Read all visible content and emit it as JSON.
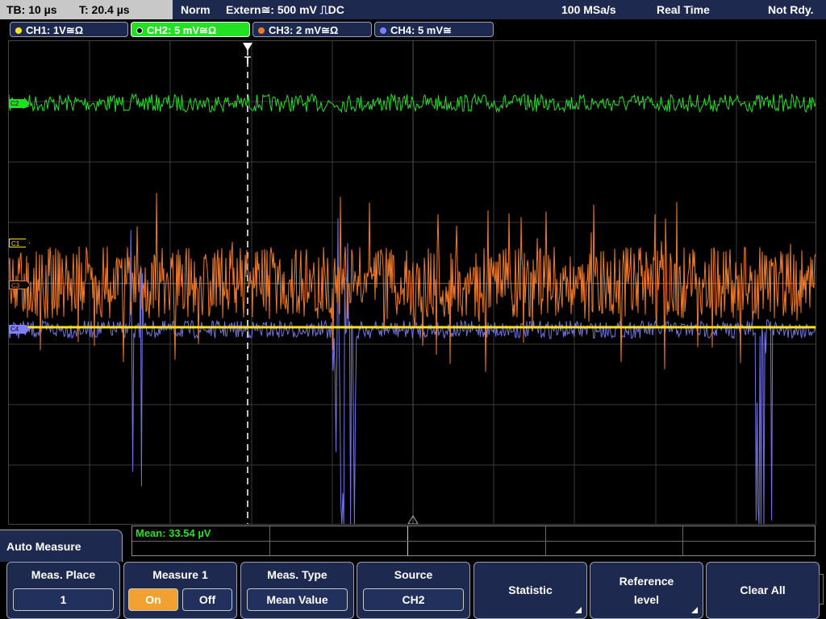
{
  "status": {
    "timebase": "TB: 10 µs",
    "trigger_pos": "T: 20.4 µs",
    "mode": "Norm",
    "trigger": "Extern≅: 500 mV ⎍DC",
    "sample_rate": "100 MSa/s",
    "acq_mode": "Real Time",
    "state": "Not Rdy."
  },
  "channels": [
    {
      "label": "CH1: 1V≅Ω",
      "color": "#ffe21e"
    },
    {
      "label": "CH2: 5 mV≅Ω",
      "color": "#22e022"
    },
    {
      "label": "CH3: 2 mV≅Ω",
      "color": "#f07a2a"
    },
    {
      "label": "CH4: 5 mV≅",
      "color": "#8080ff"
    }
  ],
  "markers": {
    "c1": "C1",
    "c2": "C2",
    "c3": "C3",
    "c4": "C4",
    "trigger": "T"
  },
  "measurement": {
    "result": "Mean: 33.54 µV"
  },
  "menu": {
    "title": "Auto Measure",
    "softkeys": {
      "meas_place": {
        "label": "Meas. Place",
        "value": "1"
      },
      "measure1": {
        "label": "Measure 1",
        "on": "On",
        "off": "Off"
      },
      "meas_type": {
        "label": "Meas. Type",
        "value": "Mean Value"
      },
      "source": {
        "label": "Source",
        "value": "CH2"
      },
      "statistic": {
        "label": "Statistic"
      },
      "reference": {
        "label1": "Reference",
        "label2": "level"
      },
      "clear": {
        "label": "Clear All"
      }
    }
  }
}
